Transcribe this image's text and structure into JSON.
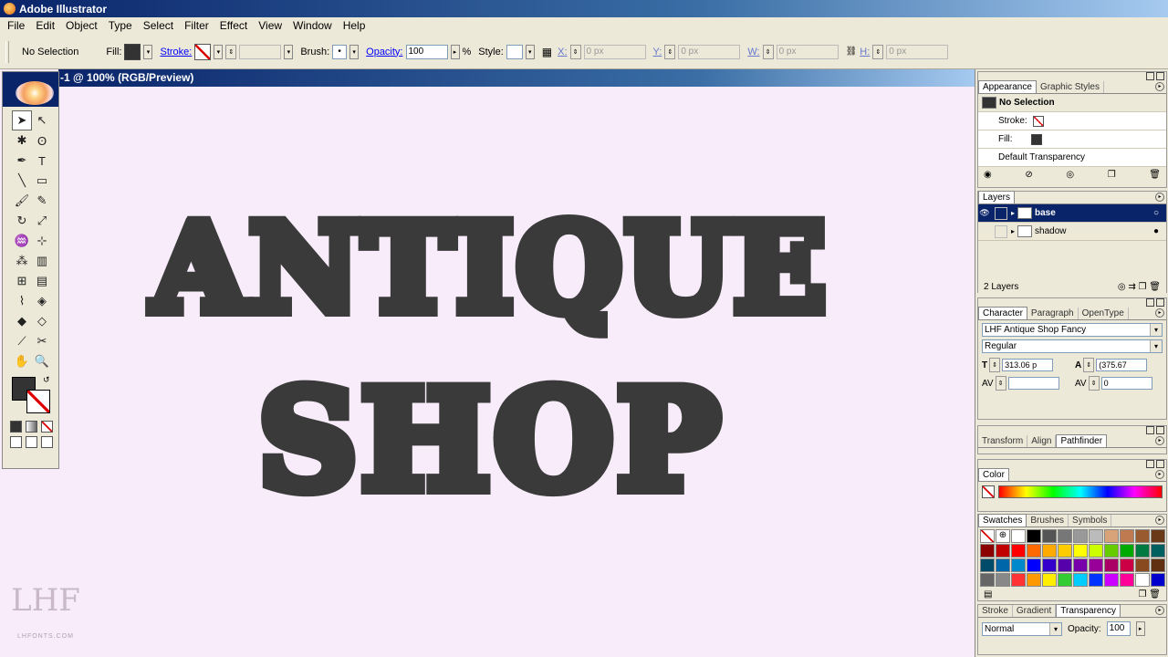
{
  "app": {
    "title": "Adobe Illustrator"
  },
  "menu": [
    "File",
    "Edit",
    "Object",
    "Type",
    "Select",
    "Filter",
    "Effect",
    "View",
    "Window",
    "Help"
  ],
  "control": {
    "selection": "No Selection",
    "fill_label": "Fill:",
    "stroke_label": "Stroke:",
    "brush_label": "Brush:",
    "brush_value": "•",
    "opacity_label": "Opacity:",
    "opacity_value": "100",
    "opacity_unit": "%",
    "style_label": "Style:",
    "x_label": "X:",
    "x_value": "0 px",
    "y_label": "Y:",
    "y_value": "0 px",
    "w_label": "W:",
    "w_value": "0 px",
    "h_label": "H:",
    "h_value": "0 px"
  },
  "document": {
    "title": "-1 @ 100% (RGB/Preview)"
  },
  "artwork": {
    "line1": "ANTIQUE",
    "line2": "SHOP",
    "color": "#3a3a3a"
  },
  "watermark": {
    "monogram": "LHF",
    "site": "LHFONTS.COM"
  },
  "appearance": {
    "tabs": [
      "Appearance",
      "Graphic Styles"
    ],
    "header": "No Selection",
    "stroke_label": "Stroke:",
    "fill_label": "Fill:",
    "transparency": "Default Transparency"
  },
  "layers": {
    "tab": "Layers",
    "items": [
      {
        "name": "base",
        "selected": true
      },
      {
        "name": "shadow",
        "selected": false
      }
    ],
    "count": "2 Layers"
  },
  "character": {
    "tabs": [
      "Character",
      "Paragraph",
      "OpenType"
    ],
    "font": "LHF Antique Shop Fancy",
    "style": "Regular",
    "size": "313.06 p",
    "leading": "(375.67",
    "kerning": "",
    "tracking": "0"
  },
  "transform": {
    "tabs": [
      "Transform",
      "Align",
      "Pathfinder"
    ]
  },
  "color_panel": {
    "tab": "Color"
  },
  "swatches": {
    "tabs": [
      "Swatches",
      "Brushes",
      "Symbols"
    ],
    "colors": [
      "none",
      "reg",
      "#ffffff",
      "#000000",
      "#555555",
      "#777777",
      "#999999",
      "#bbbbbb",
      "#d9a37a",
      "#c07a50",
      "#9a5a30",
      "#6a3a18",
      "#8b0000",
      "#c00000",
      "#ff0000",
      "#ff6a00",
      "#ffaa00",
      "#ffcc00",
      "#ffff00",
      "#ccff00",
      "#66cc00",
      "#00aa00",
      "#007a40",
      "#006060",
      "#004a6a",
      "#0066aa",
      "#0088cc",
      "#0000ff",
      "#3300cc",
      "#5500aa",
      "#7700aa",
      "#990099",
      "#aa0066",
      "#cc0044",
      "#8a4a20",
      "#603010",
      "#666666",
      "#888888",
      "#ff3333",
      "#ff9900",
      "#ffee00",
      "#33cc33",
      "#00ccff",
      "#0033ff",
      "#cc00ff",
      "#ff0099",
      "#ffffff",
      "#0000cc"
    ]
  },
  "transparency": {
    "tabs": [
      "Stroke",
      "Gradient",
      "Transparency"
    ],
    "mode": "Normal",
    "opacity_label": "Opacity:",
    "opacity_value": "100"
  }
}
